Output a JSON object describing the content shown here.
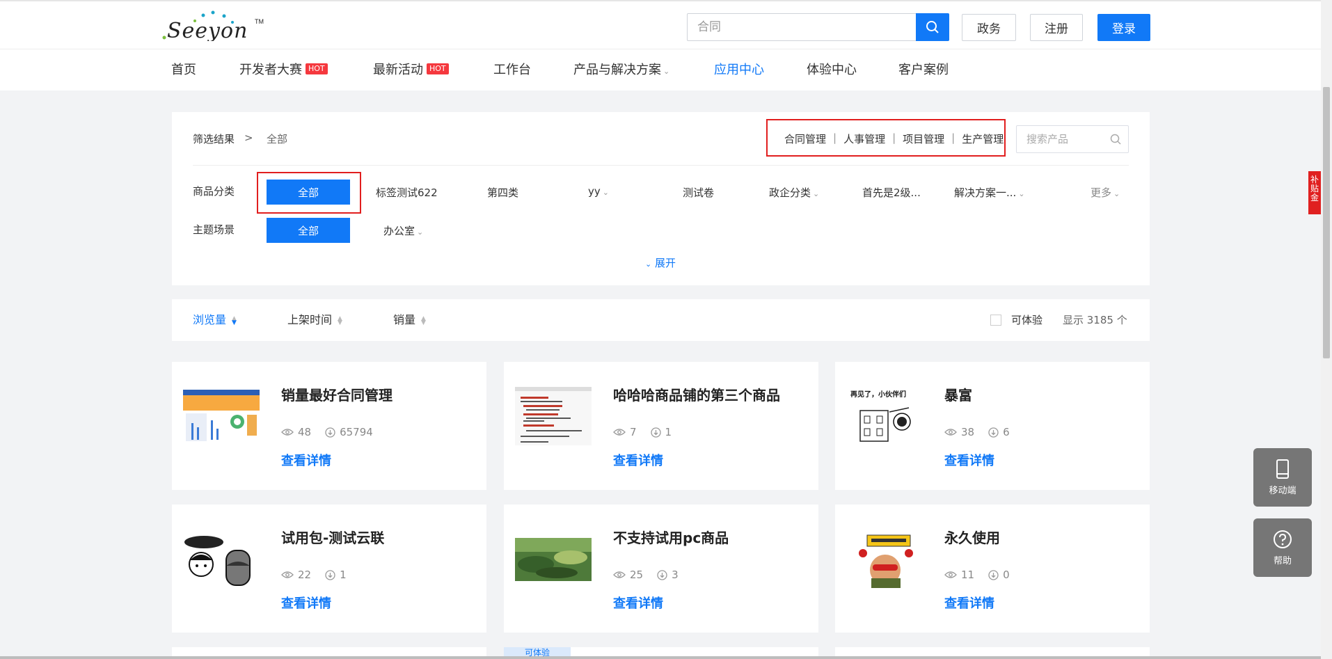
{
  "header": {
    "logo_text": "Seeyon",
    "search_placeholder": "合同",
    "btn_gov": "政务",
    "btn_register": "注册",
    "btn_login": "登录"
  },
  "nav": {
    "items": [
      {
        "label": "首页"
      },
      {
        "label": "开发者大赛",
        "badge": "HOT"
      },
      {
        "label": "最新活动",
        "badge": "HOT"
      },
      {
        "label": "工作台"
      },
      {
        "label": "产品与解决方案"
      },
      {
        "label": "应用中心",
        "active": true
      },
      {
        "label": "体验中心"
      },
      {
        "label": "客户案例"
      }
    ]
  },
  "filter": {
    "breadcrumb_label": "筛选结果",
    "breadcrumb_sep": ">",
    "breadcrumb_value": "全部",
    "quick_links": [
      "合同管理",
      "人事管理",
      "项目管理",
      "生产管理"
    ],
    "product_search_placeholder": "搜索产品",
    "category_label": "商品分类",
    "category_all": "全部",
    "categories": [
      "标签测试622",
      "第四类",
      "yy",
      "测试卷",
      "政企分类",
      "首先是2级...",
      "解决方案一...",
      "更多"
    ],
    "scene_label": "主题场景",
    "scene_all": "全部",
    "scenes": [
      "办公室"
    ],
    "expand_label": "展开"
  },
  "sortbar": {
    "sorts": [
      "浏览量",
      "上架时间",
      "销量"
    ],
    "trial_label": "可体验",
    "count_text": "显示 3185 个"
  },
  "cards": [
    {
      "title": "销量最好合同管理",
      "views": "48",
      "downloads": "65794",
      "link": "查看详情"
    },
    {
      "title": "哈哈哈商品铺的第三个商品",
      "views": "7",
      "downloads": "1",
      "link": "查看详情"
    },
    {
      "title": "暴富",
      "views": "38",
      "downloads": "6",
      "link": "查看详情",
      "thumb_caption": "再见了，小伙伴们"
    },
    {
      "title": "试用包-测试云联",
      "views": "22",
      "downloads": "1",
      "link": "查看详情"
    },
    {
      "title": "不支持试用pc商品",
      "views": "25",
      "downloads": "3",
      "link": "查看详情"
    },
    {
      "title": "永久使用",
      "views": "11",
      "downloads": "0",
      "link": "查看详情"
    }
  ],
  "partial_tag": "可体验",
  "floating": {
    "mobile_label": "移动端",
    "help_label": "帮助",
    "side_tab": "补贴金"
  },
  "colors": {
    "primary": "#1179f7",
    "hot": "#f5383e",
    "highlight": "#e11e1e"
  }
}
